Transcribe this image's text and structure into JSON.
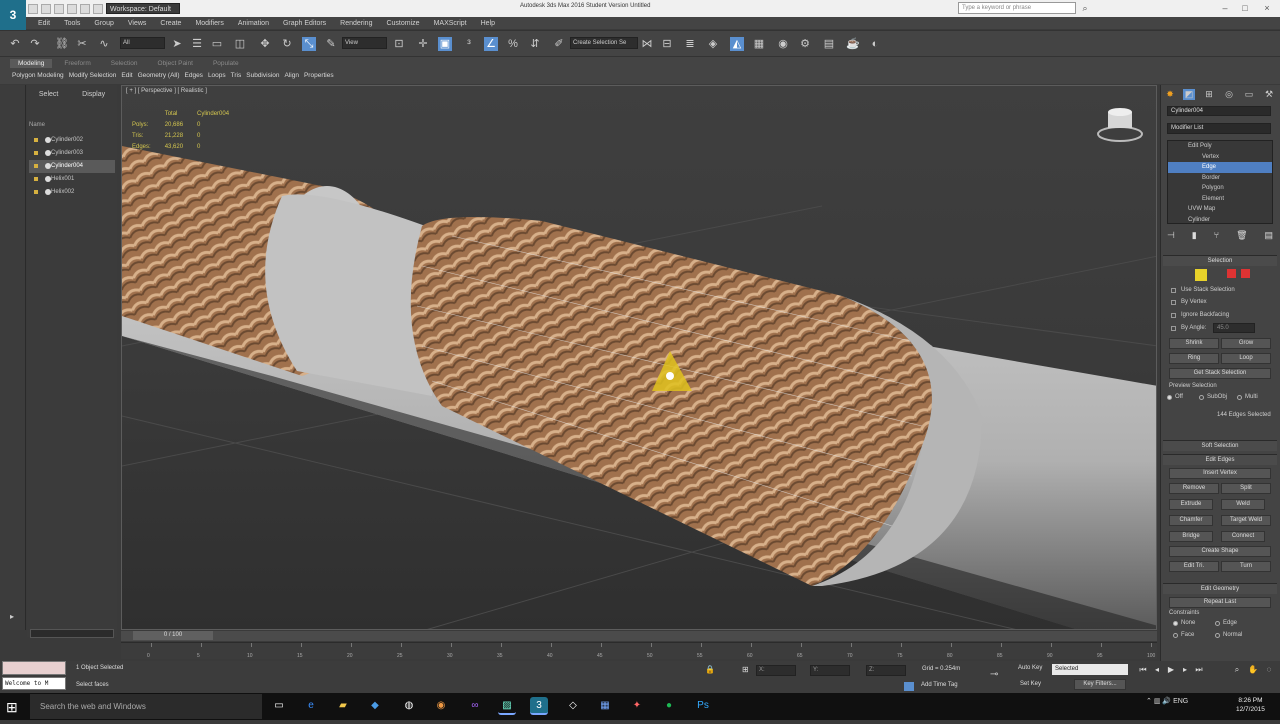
{
  "title_bar": {
    "workspace": "Workspace: Default",
    "window_title": "Autodesk 3ds Max 2016   Student Version   Untitled",
    "help_search_placeholder": "Type a keyword or phrase"
  },
  "menu": [
    "Edit",
    "Tools",
    "Group",
    "Views",
    "Create",
    "Modifiers",
    "Animation",
    "Graph Editors",
    "Rendering",
    "Customize",
    "MAXScript",
    "Help"
  ],
  "toolbar": {
    "selection_filter": "All",
    "reference_coord": "View",
    "named_selection": "Create Selection Se"
  },
  "ribbon": {
    "tabs": [
      "Modeling",
      "Freeform",
      "Selection",
      "Object Paint",
      "Populate"
    ],
    "active_tab": "Modeling",
    "items": [
      "Polygon Modeling",
      "Modify Selection",
      "Edit",
      "Geometry (All)",
      "Edges",
      "Loops",
      "Tris",
      "Subdivision",
      "Align",
      "Properties"
    ]
  },
  "scene_explorer": {
    "tabs": [
      "Select",
      "Display"
    ],
    "header": "Name",
    "items": [
      {
        "name": "Cylinder002",
        "selected": false
      },
      {
        "name": "Cylinder003",
        "selected": false
      },
      {
        "name": "Cylinder004",
        "selected": true
      },
      {
        "name": "Helix001",
        "selected": false
      },
      {
        "name": "Helix002",
        "selected": false
      }
    ]
  },
  "viewport": {
    "label": "[ + ] [ Perspective ] [ Realistic ]",
    "stats": {
      "col_total": "Total",
      "col_object": "Cylinder004",
      "rows": [
        {
          "label": "Polys:",
          "total": "20,686",
          "object": "0"
        },
        {
          "label": "Tris:",
          "total": "21,228",
          "object": "0"
        },
        {
          "label": "Edges:",
          "total": "43,620",
          "object": "0"
        }
      ]
    }
  },
  "command_panel": {
    "object_name": "Cylinder004",
    "modifier_list": "Modifier List",
    "stack": [
      {
        "label": "Edit Poly",
        "level": 0,
        "selected": false
      },
      {
        "label": "Vertex",
        "level": 1,
        "selected": false
      },
      {
        "label": "Edge",
        "level": 1,
        "selected": true
      },
      {
        "label": "Border",
        "level": 1,
        "selected": false
      },
      {
        "label": "Polygon",
        "level": 1,
        "selected": false
      },
      {
        "label": "Element",
        "level": 1,
        "selected": false
      },
      {
        "label": "UVW Map",
        "level": 0,
        "selected": false
      },
      {
        "label": "Cylinder",
        "level": 0,
        "selected": false
      }
    ],
    "selection_rollout": "Selection",
    "use_stack_selection": "Use Stack Selection",
    "by_vertex": "By Vertex",
    "ignore_backfacing": "Ignore Backfacing",
    "by_angle": "By Angle:",
    "by_angle_value": "45.0",
    "shrink": "Shrink",
    "grow": "Grow",
    "ring": "Ring",
    "loop": "Loop",
    "get_stack_selection": "Get Stack Selection",
    "preview_selection": "Preview Selection",
    "preview_off": "Off",
    "preview_subobj": "SubObj",
    "preview_multi": "Multi",
    "edges_selected": "144 Edges Selected",
    "soft_selection": "Soft Selection",
    "edit_edges": "Edit Edges",
    "insert_vertex": "Insert Vertex",
    "remove": "Remove",
    "split": "Split",
    "extrude": "Extrude",
    "weld": "Weld",
    "chamfer": "Chamfer",
    "target_weld": "Target Weld",
    "bridge": "Bridge",
    "connect": "Connect",
    "create_shape": "Create Shape",
    "edit_tri": "Edit Tri.",
    "turn": "Turn",
    "edit_geometry": "Edit Geometry",
    "repeat_last": "Repeat Last",
    "constraints": "Constraints",
    "none": "None",
    "edge": "Edge",
    "face": "Face",
    "normal": "Normal"
  },
  "timeline": {
    "frame": "0 / 100",
    "ticks": [
      "0",
      "5",
      "10",
      "15",
      "20",
      "25",
      "30",
      "35",
      "40",
      "45",
      "50",
      "55",
      "60",
      "65",
      "70",
      "75",
      "80",
      "85",
      "90",
      "95",
      "100"
    ]
  },
  "status": {
    "maxscript": "Welcome to M",
    "selection": "1 Object Selected",
    "prompt": "Select faces",
    "x": "X:",
    "y": "Y:",
    "z": "Z:",
    "grid": "Grid = 0.254m",
    "add_time_tag": "Add Time Tag",
    "auto_key": "Auto Key",
    "selected": "Selected",
    "set_key": "Set Key",
    "key_filters": "Key Filters..."
  },
  "taskbar": {
    "search": "Search the web and Windows",
    "language": "ENG",
    "time": "8:26 PM",
    "date": "12/7/2015"
  },
  "colors": {
    "accent": "#5a8fcf",
    "rope": "#a97a55",
    "pipe": "#b8b8b8"
  }
}
